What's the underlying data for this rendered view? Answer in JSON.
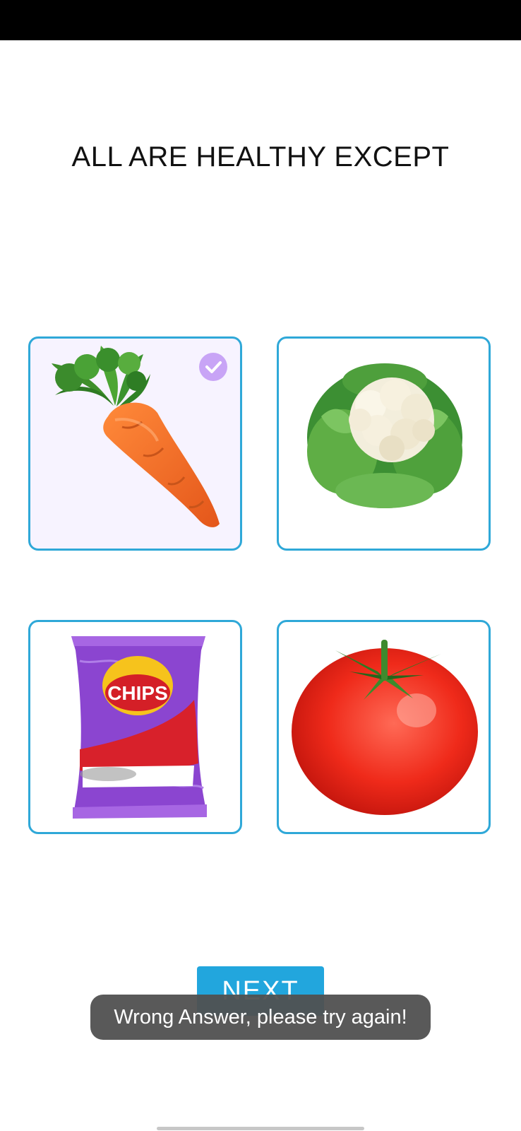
{
  "question": {
    "text": "ALL ARE HEALTHY EXCEPT"
  },
  "options": [
    {
      "id": "carrot",
      "selected": true,
      "icon": "carrot-image"
    },
    {
      "id": "cauliflower",
      "selected": false,
      "icon": "cauliflower-image"
    },
    {
      "id": "chips",
      "selected": false,
      "icon": "chips-packet-image",
      "label": "CHIPS"
    },
    {
      "id": "tomato",
      "selected": false,
      "icon": "tomato-image"
    }
  ],
  "next_button": {
    "label": "NEXT"
  },
  "toast": {
    "message": "Wrong Answer, please try again!"
  },
  "colors": {
    "card_border": "#2fa8d8",
    "selected_bg": "#f7f3ff",
    "check_badge": "#c8a4f6",
    "button_bg": "#22a6dd",
    "toast_bg": "#505050"
  }
}
